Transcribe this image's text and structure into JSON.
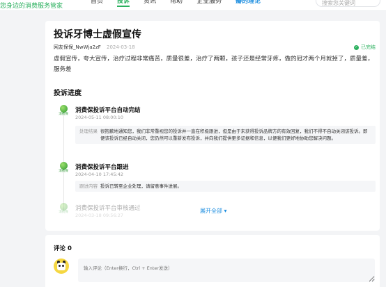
{
  "header": {
    "brand": "您身边的消费服务管家",
    "nav": [
      "首页",
      "投诉",
      "资讯",
      "帮助",
      "企业服务",
      "瓣的理论"
    ],
    "active_nav": "投诉",
    "search_placeholder": "搜索您关键词"
  },
  "complaint": {
    "title": "投诉牙博士虚假宣传",
    "user": "网友保保_NwWja2zF",
    "date": "2024-03-18",
    "status": "已完结",
    "description": "虚假宣传，夸大宣传，治疗过程非常痛苦，质量很差，治疗了两颗，孩子还是经常牙疼，做的冠才两个月就掉了，质量差，服务差"
  },
  "progress": {
    "section_title": "投诉进度",
    "icon_label": "消费保",
    "steps": [
      {
        "title": "消费保投诉平台自动完结",
        "date": "2024-05-11 08:00:10",
        "box_label": "处理结果",
        "box_text": "很抱歉地通知您，我们非常重视您的投诉并一直在积极跟进，但是由于未获得投诉品牌方的有效回复，我们不得不自动关闭该投诉。即便该投诉已经自动关闭，您仍然可以重新发布投诉，并向我们提供更多证据和信息，以便我们更好地协助您解决问题。"
      },
      {
        "title": "消费保投诉平台跟进",
        "date": "2024-04-10 17:45:42",
        "box_label": "跟进内容",
        "box_text": "投诉已转至企业处理，请留意事件进展。"
      },
      {
        "title": "消费保投诉平台审核通过",
        "date": "2024-03-18 09:56:27"
      }
    ],
    "expand_label": "展开全部 ▾"
  },
  "comments": {
    "title": "评论 0",
    "placeholder": "输入评论（Enter换行，Ctrl + Enter发送）"
  },
  "colors": {
    "accent_green": "#2bb05e",
    "link_blue": "#1f8fe0"
  }
}
